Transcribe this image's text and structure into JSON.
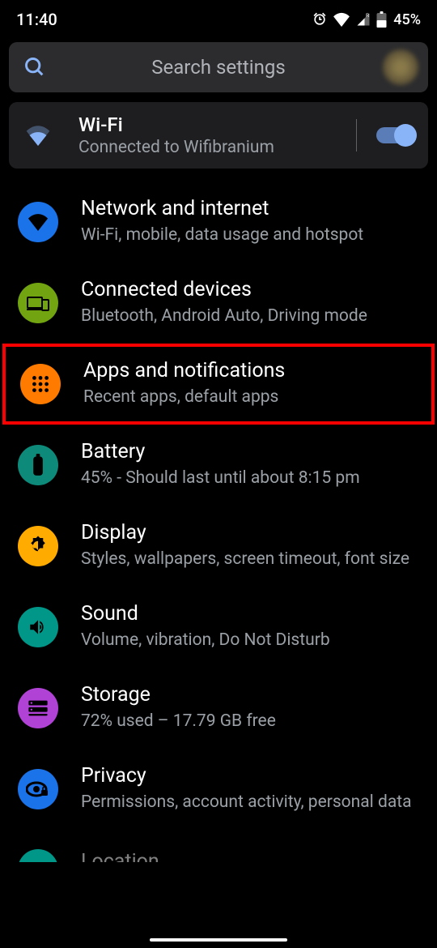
{
  "status": {
    "time": "11:40",
    "battery_pct": "45%"
  },
  "search": {
    "placeholder": "Search settings"
  },
  "wifi_card": {
    "title": "Wi-Fi",
    "subtitle": "Connected to Wifibranium",
    "toggle_on": true
  },
  "items": [
    {
      "title": "Network and internet",
      "sub": "Wi-Fi, mobile, data usage and hotspot",
      "icon": "wifi-icon",
      "bg": "#1a73e8",
      "fg": "#000000",
      "highlighted": false
    },
    {
      "title": "Connected devices",
      "sub": "Bluetooth, Android Auto, Driving mode",
      "icon": "devices-icon",
      "bg": "#71a410",
      "fg": "#000000",
      "highlighted": false
    },
    {
      "title": "Apps and notifications",
      "sub": "Recent apps, default apps",
      "icon": "apps-icon",
      "bg": "#ff7b00",
      "fg": "#000000",
      "highlighted": true
    },
    {
      "title": "Battery",
      "sub": "45% - Should last until about 8:15 pm",
      "icon": "battery-icon",
      "bg": "#0d8a7a",
      "fg": "#000000",
      "highlighted": false
    },
    {
      "title": "Display",
      "sub": "Styles, wallpapers, screen timeout, font size",
      "icon": "brightness-icon",
      "bg": "#ffab00",
      "fg": "#000000",
      "highlighted": false
    },
    {
      "title": "Sound",
      "sub": "Volume, vibration, Do Not Disturb",
      "icon": "sound-icon",
      "bg": "#009688",
      "fg": "#000000",
      "highlighted": false
    },
    {
      "title": "Storage",
      "sub": "72% used – 17.79 GB free",
      "icon": "storage-icon",
      "bg": "#b142d6",
      "fg": "#000000",
      "highlighted": false
    },
    {
      "title": "Privacy",
      "sub": "Permissions, account activity, personal data",
      "icon": "privacy-icon",
      "bg": "#1a73e8",
      "fg": "#000000",
      "highlighted": false
    }
  ],
  "partial_item": {
    "title": "Location",
    "bg": "#009688"
  }
}
